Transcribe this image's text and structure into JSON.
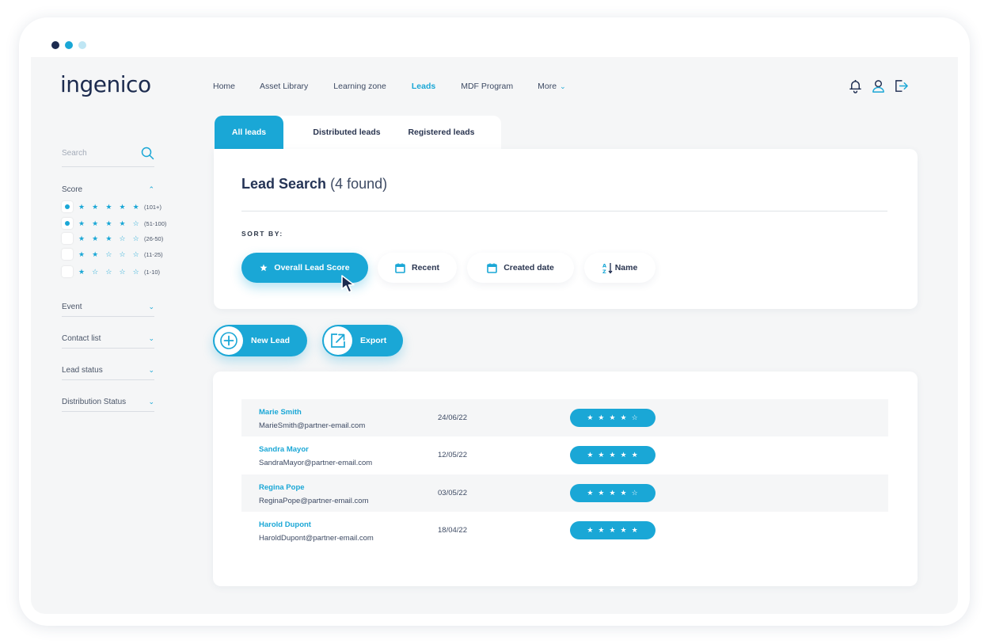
{
  "window": {
    "dot_colors": [
      "#1c2b4f",
      "#1aa7d6",
      "#bfe6f4"
    ]
  },
  "brand": {
    "logo": "ingenico",
    "accent": "#1aa7d6",
    "navy": "#1c2b4f"
  },
  "nav": {
    "items": [
      "Home",
      "Asset Library",
      "Learning zone",
      "Leads",
      "MDF Program",
      "More"
    ],
    "active": "Leads",
    "icons": [
      "notification-bell-icon",
      "user-icon",
      "logout-icon"
    ]
  },
  "sidebar": {
    "search_placeholder": "Search",
    "score_label": "Score",
    "score_options": [
      {
        "stars": "★ ★ ★ ★ ★",
        "range": "(101+)",
        "checked": true
      },
      {
        "stars": "★ ★ ★ ★ ☆",
        "range": "(51-100)",
        "checked": true
      },
      {
        "stars": "★ ★ ★ ☆ ☆",
        "range": "(26-50)",
        "checked": false
      },
      {
        "stars": "★ ★ ☆ ☆ ☆",
        "range": "(11-25)",
        "checked": false
      },
      {
        "stars": "★ ☆ ☆ ☆ ☆",
        "range": "(1-10)",
        "checked": false
      }
    ],
    "filters": [
      "Event",
      "Contact list",
      "Lead status",
      "Distribution Status"
    ]
  },
  "tabs": [
    "All leads",
    "Distributed leads",
    "Registered leads"
  ],
  "search": {
    "title": "Lead Search",
    "count": "(4 found)",
    "sort_label": "SORT BY:",
    "sort_options": [
      "Overall Lead Score",
      "Recent",
      "Created date",
      "Name"
    ]
  },
  "actions": {
    "new_lead": "New Lead",
    "export": "Export"
  },
  "leads": [
    {
      "name": "Marie Smith",
      "email": "MarieSmith@partner-email.com",
      "date": "24/06/22",
      "stars": "★★★★☆"
    },
    {
      "name": "Sandra Mayor",
      "email": "SandraMayor@partner-email.com",
      "date": "12/05/22",
      "stars": "★★★★★"
    },
    {
      "name": "Regina Pope",
      "email": "ReginaPope@partner-email.com",
      "date": "03/05/22",
      "stars": "★★★★☆"
    },
    {
      "name": "Harold Dupont",
      "email": "HaroldDupont@partner-email.com",
      "date": "18/04/22",
      "stars": "★★★★★"
    }
  ]
}
